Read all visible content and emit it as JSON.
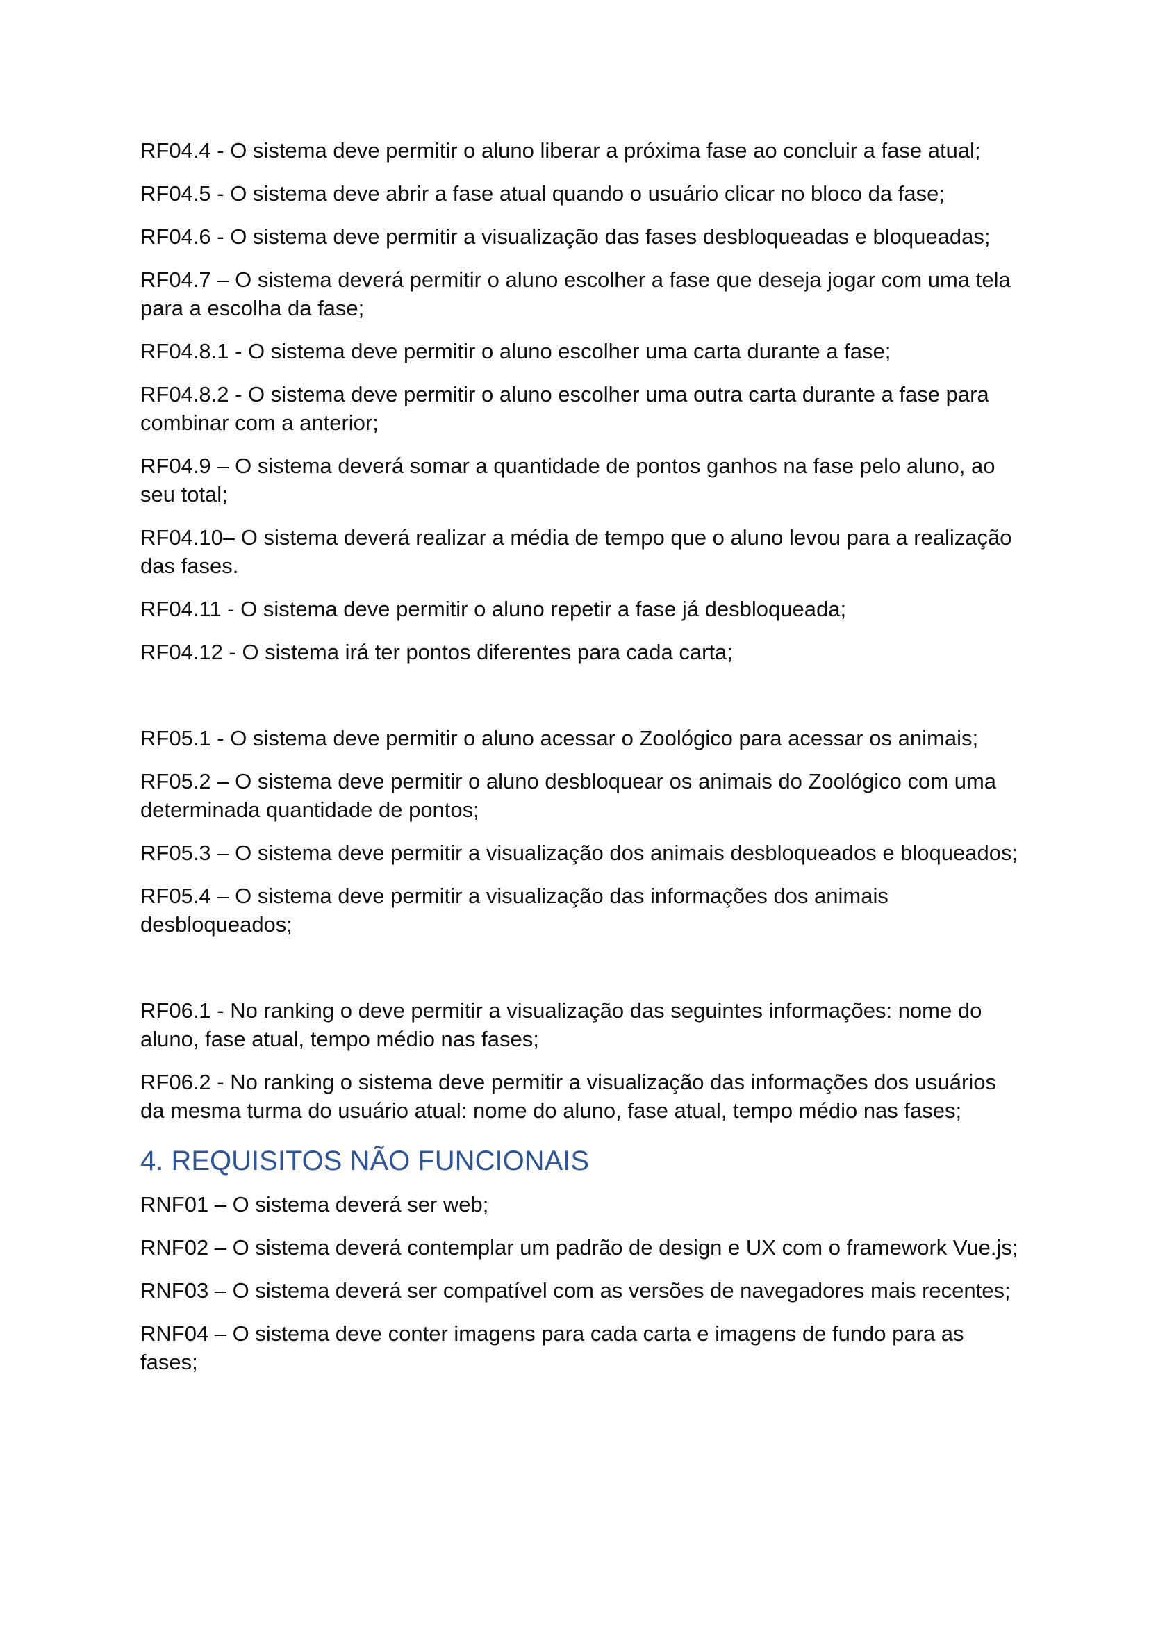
{
  "rf04": [
    "RF04.4 - O sistema deve permitir o aluno liberar a próxima fase ao concluir a fase atual;",
    "RF04.5 - O sistema deve abrir a fase atual quando o usuário clicar no bloco da fase;",
    "RF04.6 - O sistema deve permitir a visualização das fases desbloqueadas e bloqueadas;",
    "RF04.7 – O sistema deverá permitir o aluno escolher a fase que deseja jogar com uma tela para a escolha da fase;",
    "RF04.8.1 - O sistema deve permitir o aluno escolher uma carta durante a fase;",
    "RF04.8.2 - O sistema deve permitir o aluno escolher uma outra carta durante a fase para combinar com a anterior;",
    "RF04.9 – O sistema deverá somar a quantidade de pontos ganhos na fase pelo aluno, ao seu total;",
    "RF04.10– O sistema deverá realizar a média de tempo que o aluno levou para a realização das fases.",
    "RF04.11 - O sistema deve permitir o aluno repetir a fase já desbloqueada;",
    "RF04.12 - O sistema irá ter pontos diferentes para cada carta;"
  ],
  "rf05": [
    "RF05.1 - O sistema deve permitir o aluno acessar o Zoológico para acessar os animais;",
    "RF05.2 – O sistema deve permitir o aluno desbloquear os animais do Zoológico com uma determinada quantidade de pontos;",
    "RF05.3 – O sistema deve permitir a visualização dos animais desbloqueados e bloqueados;",
    "RF05.4 – O sistema deve permitir a visualização das informações dos animais desbloqueados;"
  ],
  "rf06": [
    "RF06.1 - No ranking o deve permitir a visualização das seguintes informações: nome do aluno, fase atual, tempo médio nas fases;",
    "RF06.2 - No ranking o sistema deve permitir a visualização das informações dos usuários da mesma turma do usuário atual: nome do aluno, fase atual, tempo médio nas fases;"
  ],
  "section4": {
    "heading": "4. REQUISITOS NÃO FUNCIONAIS",
    "heading_color": "#2f5597",
    "items": [
      "RNF01 – O sistema deverá ser web;",
      "RNF02 – O sistema deverá contemplar um padrão de design e UX com o framework Vue.js;",
      "RNF03 – O sistema deverá ser compatível com as versões de navegadores mais recentes;",
      "RNF04 – O sistema deve conter imagens para cada carta e imagens de fundo para as fases;"
    ]
  }
}
